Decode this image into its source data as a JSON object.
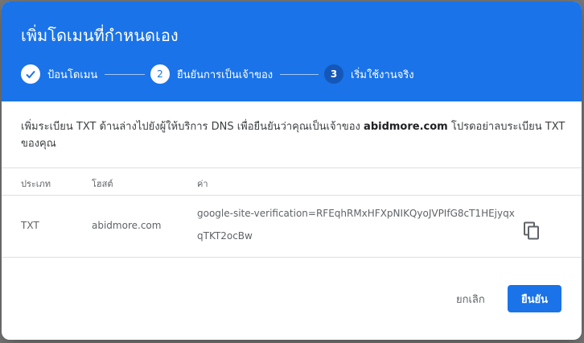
{
  "backdrop": {
    "text": "เพิ่มโดเมนที่กำหนดเอง"
  },
  "dialog": {
    "title": "เพิ่มโดเมนที่กำหนดเอง",
    "steps": [
      {
        "number": "1",
        "label": "ป้อนโดเมน",
        "state": "done"
      },
      {
        "number": "2",
        "label": "ยืนยันการเป็นเจ้าของ",
        "state": "active"
      },
      {
        "number": "3",
        "label": "เริ่มใช้งานจริง",
        "state": "pending"
      }
    ],
    "description": {
      "prefix": "เพิ่มระเบียน TXT ด้านล่างไปยังผู้ให้บริการ DNS เพื่อยืนยันว่าคุณเป็นเจ้าของ ",
      "domain": "abidmore.com",
      "suffix": " โปรดอย่าลบระเบียน TXT ของคุณ"
    },
    "table": {
      "headers": {
        "type": "ประเภท",
        "host": "โฮสต์",
        "value": "ค่า"
      },
      "row": {
        "type": "TXT",
        "host": "abidmore.com",
        "value": "google-site-verification=RFEqhRMxHFXpNIKQyoJVPIfG8cT1HEjyqxqTKT2ocBw"
      }
    },
    "buttons": {
      "cancel": "ยกเลิก",
      "confirm": "ยืนยัน"
    }
  },
  "colors": {
    "primary": "#1a73e8",
    "pending_step": "#1557b8"
  },
  "icons": {
    "check": "check-icon",
    "copy": "copy-icon"
  }
}
